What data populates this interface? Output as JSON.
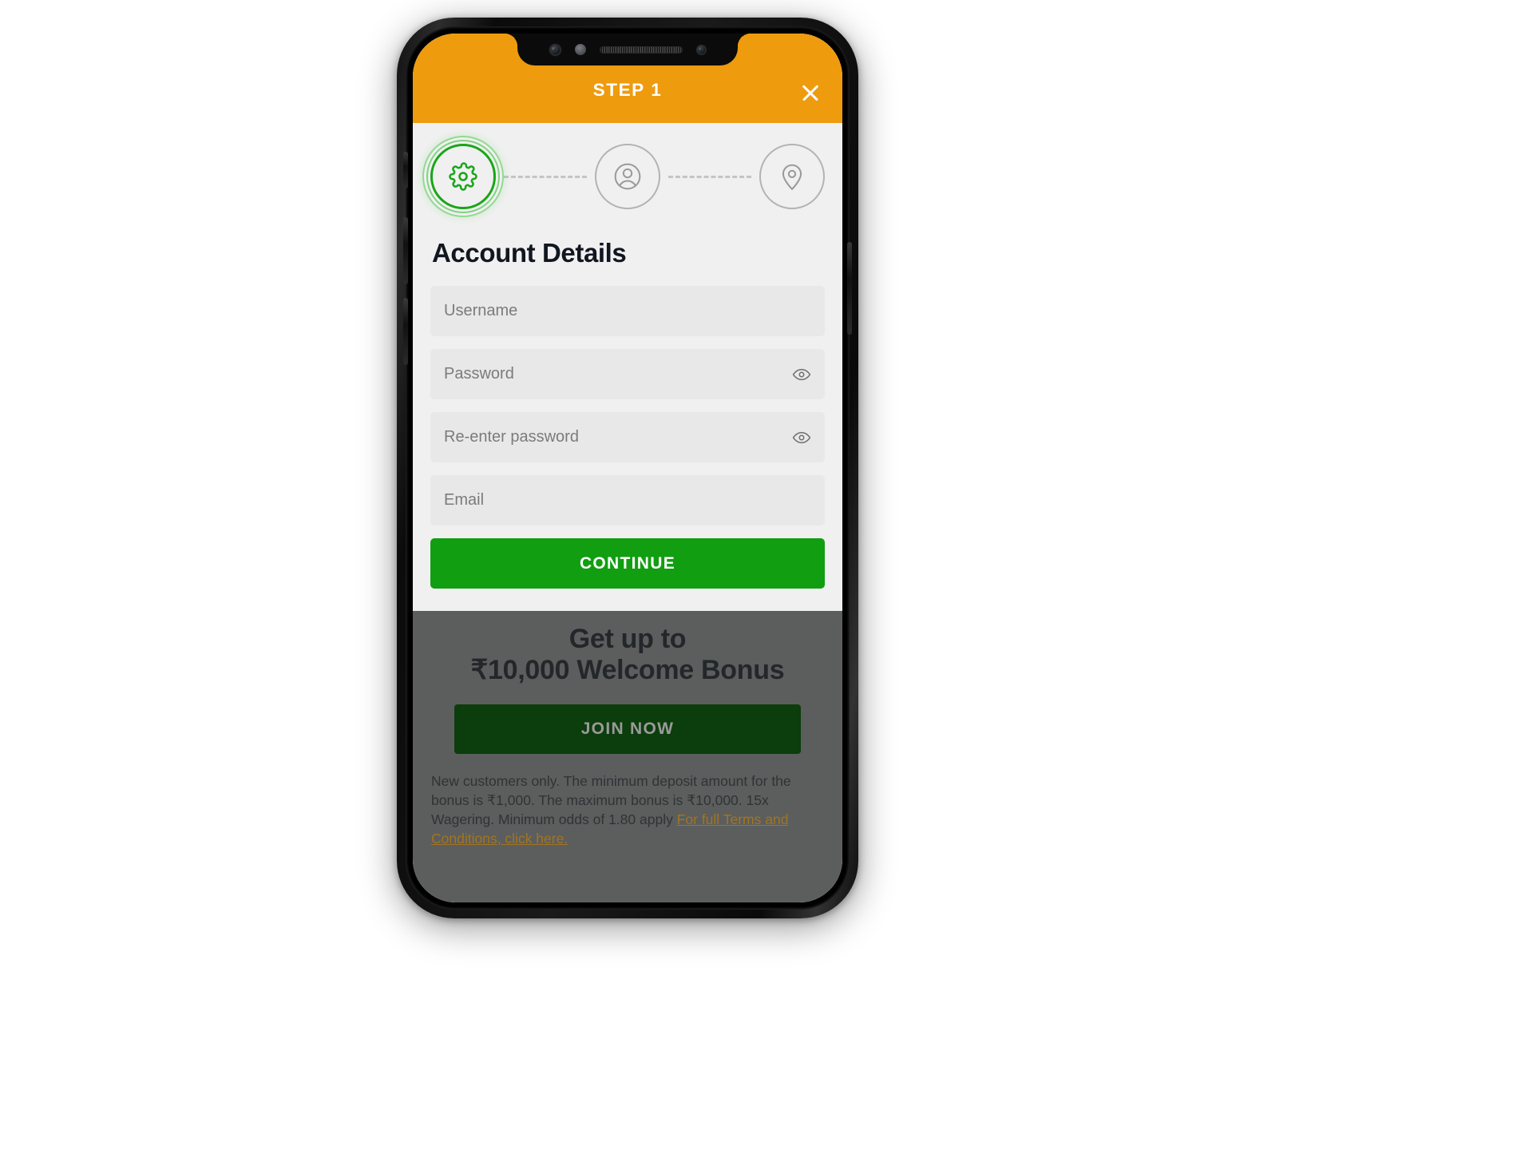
{
  "header": {
    "title": "STEP 1",
    "close_icon": "close-icon",
    "background_color": "#ee9b0e",
    "title_color": "#ffffff"
  },
  "steps": [
    {
      "id": "account",
      "icon": "gear-icon",
      "state": "active",
      "color": "#19a519"
    },
    {
      "id": "personal",
      "icon": "user-circle-icon",
      "state": "idle",
      "color": "#b3b3b3"
    },
    {
      "id": "address",
      "icon": "location-pin-icon",
      "state": "idle",
      "color": "#b3b3b3"
    }
  ],
  "form": {
    "section_title": "Account Details",
    "fields": [
      {
        "name": "username",
        "placeholder": "Username",
        "value": "",
        "type": "text",
        "has_eye": false
      },
      {
        "name": "password",
        "placeholder": "Password",
        "value": "",
        "type": "password",
        "has_eye": true
      },
      {
        "name": "confirm_password",
        "placeholder": "Re-enter password",
        "value": "",
        "type": "password",
        "has_eye": true
      },
      {
        "name": "email",
        "placeholder": "Email",
        "value": "",
        "type": "email",
        "has_eye": false
      }
    ],
    "submit_label": "CONTINUE",
    "submit_color": "#119e11"
  },
  "bonus": {
    "headline_line1": "Get up to",
    "headline_line2": "₹10,000 Welcome Bonus",
    "join_label": "JOIN NOW",
    "join_color": "#0c3d0c",
    "terms_text": "New customers only. The minimum deposit amount for the bonus is ₹1,000. The maximum bonus is ₹10,000. 15x Wagering. Minimum odds of 1.80 apply ",
    "terms_link": "For full Terms and Conditions, click here.",
    "terms_link_color": "#a37422",
    "overlay_color": "#5b5e5d"
  },
  "device": {
    "notch_items": [
      "front-camera-icon",
      "proximity-sensor-icon",
      "earpiece-speaker-icon",
      "secondary-camera-icon"
    ]
  }
}
